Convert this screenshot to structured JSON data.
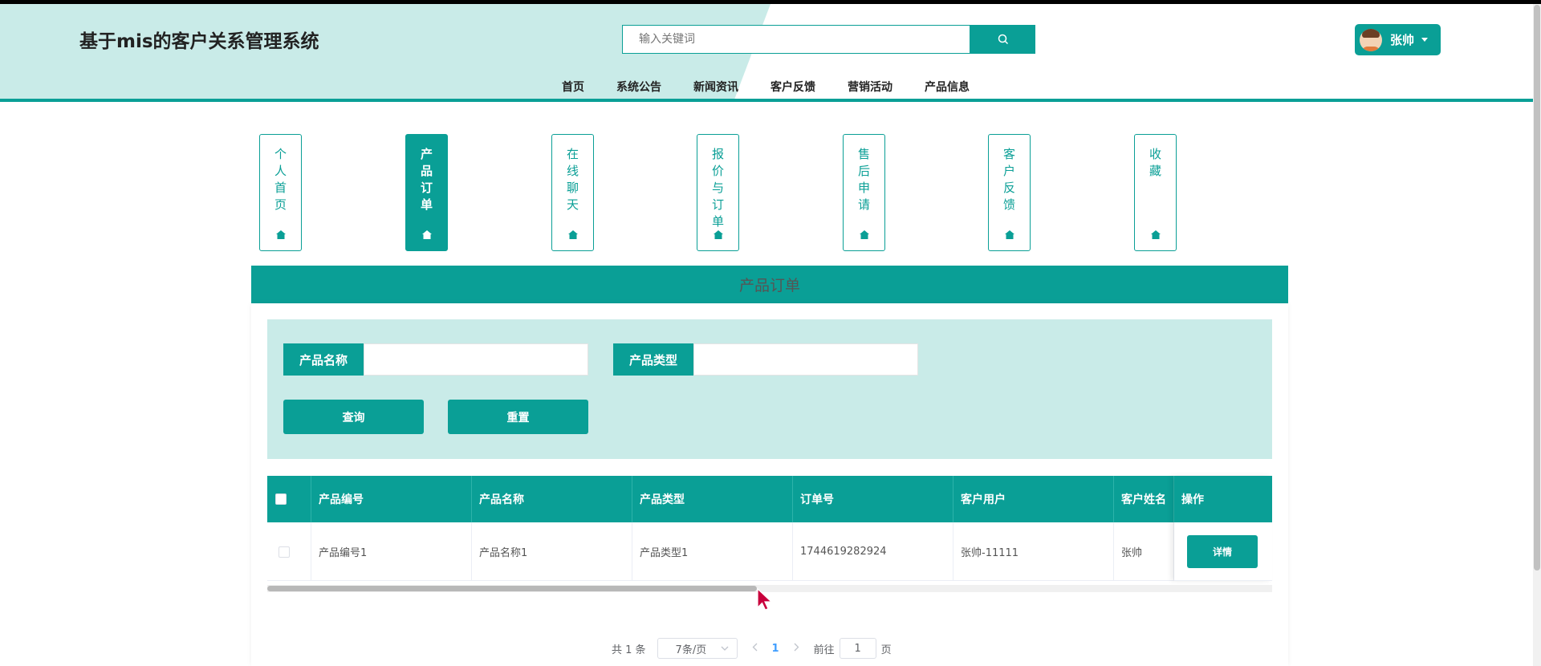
{
  "header": {
    "site_title": "基于mis的客户关系管理系统",
    "search_placeholder": "输入关键词",
    "user_name": "张帅"
  },
  "nav": {
    "items": [
      "首页",
      "系统公告",
      "新闻资讯",
      "客户反馈",
      "营销活动",
      "产品信息"
    ]
  },
  "side_tabs": [
    {
      "label": "个人首页",
      "active": false
    },
    {
      "label": "产品订单",
      "active": true
    },
    {
      "label": "在线聊天",
      "active": false
    },
    {
      "label": "报价与订单",
      "active": false
    },
    {
      "label": "售后申请",
      "active": false
    },
    {
      "label": "客户反馈",
      "active": false
    },
    {
      "label": "收藏",
      "active": false
    }
  ],
  "panel": {
    "title": "产品订单"
  },
  "filters": {
    "product_name_label": "产品名称",
    "product_name_value": "",
    "product_type_label": "产品类型",
    "product_type_value": "",
    "query_button": "查询",
    "reset_button": "重置"
  },
  "table": {
    "columns": [
      "产品编号",
      "产品名称",
      "产品类型",
      "订单号",
      "客户用户",
      "客户姓名",
      "操作"
    ],
    "rows": [
      {
        "product_no": "产品编号1",
        "product_name": "产品名称1",
        "product_type": "产品类型1",
        "order_no": "1744619282924",
        "customer_user": "张帅-11111",
        "customer_name": "张帅",
        "action": "详情"
      }
    ]
  },
  "pagination": {
    "total_text": "共 1 条",
    "page_size": "7条/页",
    "current_page": "1",
    "goto_prefix": "前往",
    "goto_value": "1",
    "goto_suffix": "页"
  },
  "colors": {
    "accent": "#0a9f96",
    "light_accent": "#c9ebe8"
  }
}
